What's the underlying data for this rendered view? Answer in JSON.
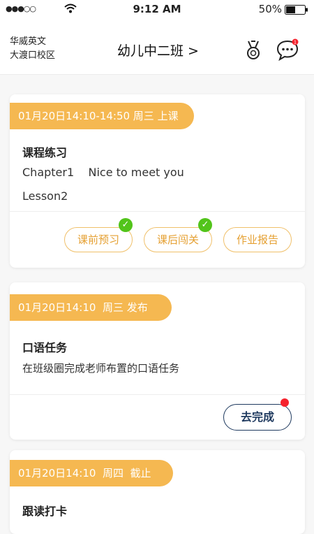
{
  "status_bar": {
    "signal": "●●●○○",
    "time": "9:12 AM",
    "battery": "50%"
  },
  "header": {
    "school_line1": "华威英文",
    "school_line2": "大渡口校区",
    "class_name": "幼儿中二班 >",
    "medal_icon": "medal-icon",
    "chat_icon": "chat-icon",
    "chat_badge": "1"
  },
  "cards": [
    {
      "time": "01月20日14:10-14:50 周三 上课",
      "title": "课程练习",
      "line1": "Chapter1    Nice to meet you",
      "line2": "Lesson2",
      "buttons": [
        "课前预习",
        "课后闯关",
        "作业报告"
      ]
    },
    {
      "time": "01月20日14:10  周三 发布",
      "title": "口语任务",
      "desc": "在班级圈完成老师布置的口语任务",
      "action": "去完成"
    },
    {
      "time": "01月20日14:10  周四  截止",
      "title": "跟读打卡"
    }
  ],
  "colors": {
    "accent": "#f5b851",
    "pill_text": "#e5a032",
    "check": "#52c41a",
    "action": "#1f3a5f",
    "alert": "#f5222d"
  }
}
